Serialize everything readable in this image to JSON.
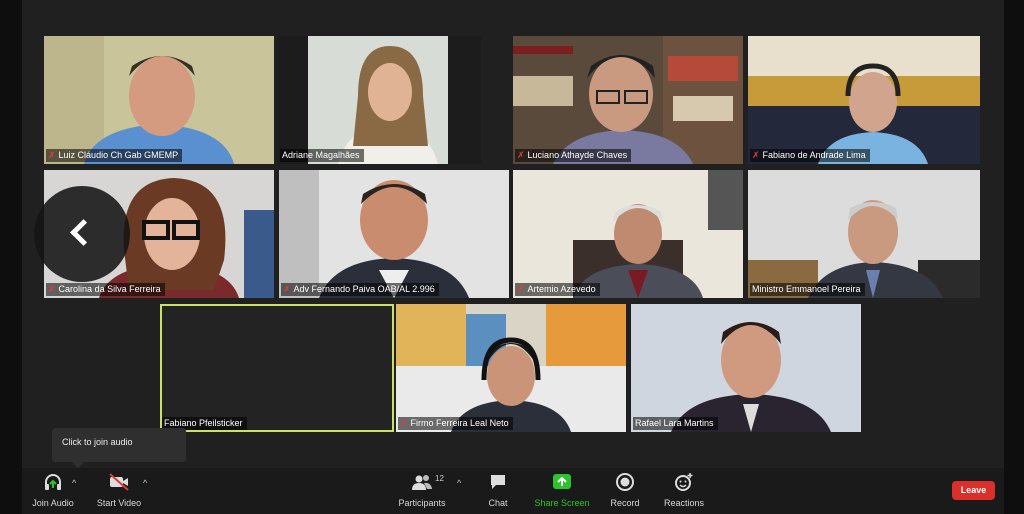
{
  "participants": [
    {
      "name": "Luiz Cláudio Ch Gab GMEMP",
      "muted": true
    },
    {
      "name": "Adriane Magalhães",
      "muted": false
    },
    {
      "name": "Luciano Athayde Chaves",
      "muted": true
    },
    {
      "name": "Fabiano de Andrade Lima",
      "muted": true
    },
    {
      "name": "Carolina da Silva Ferreira",
      "muted": true
    },
    {
      "name": "Adv Fernando Paiva OAB/AL 2.996",
      "muted": true
    },
    {
      "name": "Artemio Azevedo",
      "muted": true
    },
    {
      "name": "Ministro Emmanoel Pereira",
      "muted": false
    },
    {
      "name": "Fabiano Pfeilsticker",
      "muted": false
    },
    {
      "name": "Firmo Ferreira Leal Neto",
      "muted": true
    },
    {
      "name": "Rafael Lara Martins",
      "muted": false
    }
  ],
  "tooltip": "Click to join audio",
  "toolbar": {
    "join_audio": "Join Audio",
    "start_video": "Start Video",
    "participants": "Participants",
    "participants_count": "12",
    "chat": "Chat",
    "share_screen": "Share Screen",
    "record": "Record",
    "reactions": "Reactions",
    "leave": "Leave"
  },
  "icons": {
    "mic_muted": "mic-muted-icon",
    "prev_page": "chevron-left-icon",
    "join_audio": "headphone-icon",
    "start_video": "video-off-icon",
    "participants": "people-icon",
    "chat": "chat-bubble-icon",
    "share_screen": "share-screen-icon",
    "record": "record-icon",
    "reactions": "emoji-icon"
  },
  "colors": {
    "active_speaker": "#c9e265",
    "share_screen": "#2bc52b",
    "leave": "#d9302c",
    "muted_mic": "#e03b3b"
  }
}
